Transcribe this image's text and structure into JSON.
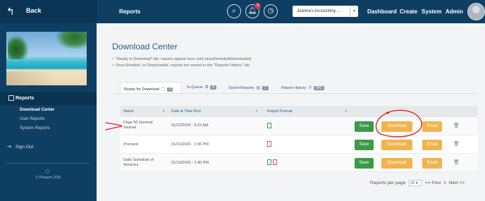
{
  "sidebar": {
    "back_label": "Back",
    "section_label": "Reports",
    "items": [
      {
        "label": "Download Center",
        "active": true
      },
      {
        "label": "User Reports",
        "active": false
      },
      {
        "label": "System Reports",
        "active": false
      }
    ],
    "signout_label": "Sign Out",
    "copyright": "© Paxsent 2020"
  },
  "topbar": {
    "title": "Reports",
    "notification_count": "3",
    "company_select": "Joanna's Accounting ...",
    "nav": [
      "Dashboard",
      "Create",
      "System",
      "Admin"
    ]
  },
  "main": {
    "title": "Download Center",
    "info": [
      "\"Ready to Download\" tab: reports appear here until saved/emailed/downloaded",
      "Once Emailed, or Downloaded, reports are moved to the \"Reports History\" tab"
    ],
    "tabs": [
      {
        "label": "Ready for Download",
        "count": "3",
        "icon": "file-icon",
        "active": true
      },
      {
        "label": "In-Queue",
        "count": "0",
        "icon": "copy-icon",
        "active": false
      },
      {
        "label": "Saved Reports",
        "count": "1",
        "icon": "saved-icon",
        "active": false
      },
      {
        "label": "Report History",
        "count": "543",
        "icon": "history-icon",
        "active": false
      }
    ],
    "table": {
      "headers": [
        "Name",
        "Date & Time Run",
        "Report Format"
      ],
      "rows": [
        {
          "name_line1": "Page 50 General",
          "name_line2": "Journal",
          "date": "01/22/2020 - 9:22 AM",
          "formats": [
            "excel"
          ]
        },
        {
          "name_line1": "Preneed",
          "name_line2": "",
          "date": "01/21/2020 - 1:06 PM",
          "formats": [
            "pdf"
          ]
        },
        {
          "name_line1": "Daily Schedule of",
          "name_line2": "Services",
          "date": "01/13/2020 - 1:40 PM",
          "formats": [
            "excel",
            "pdf"
          ]
        }
      ],
      "actions": {
        "save": "Save",
        "download": "Download",
        "email": "Email"
      }
    },
    "pager": {
      "label": "Reports per page",
      "per_page": "25",
      "prev": "<< Prev",
      "page": "1",
      "next": "Next >>"
    }
  },
  "colors": {
    "sidebar_bg": "#0e3f63",
    "save": "#3a9a4a",
    "download": "#f0b44f",
    "annotation": "#e02424"
  }
}
